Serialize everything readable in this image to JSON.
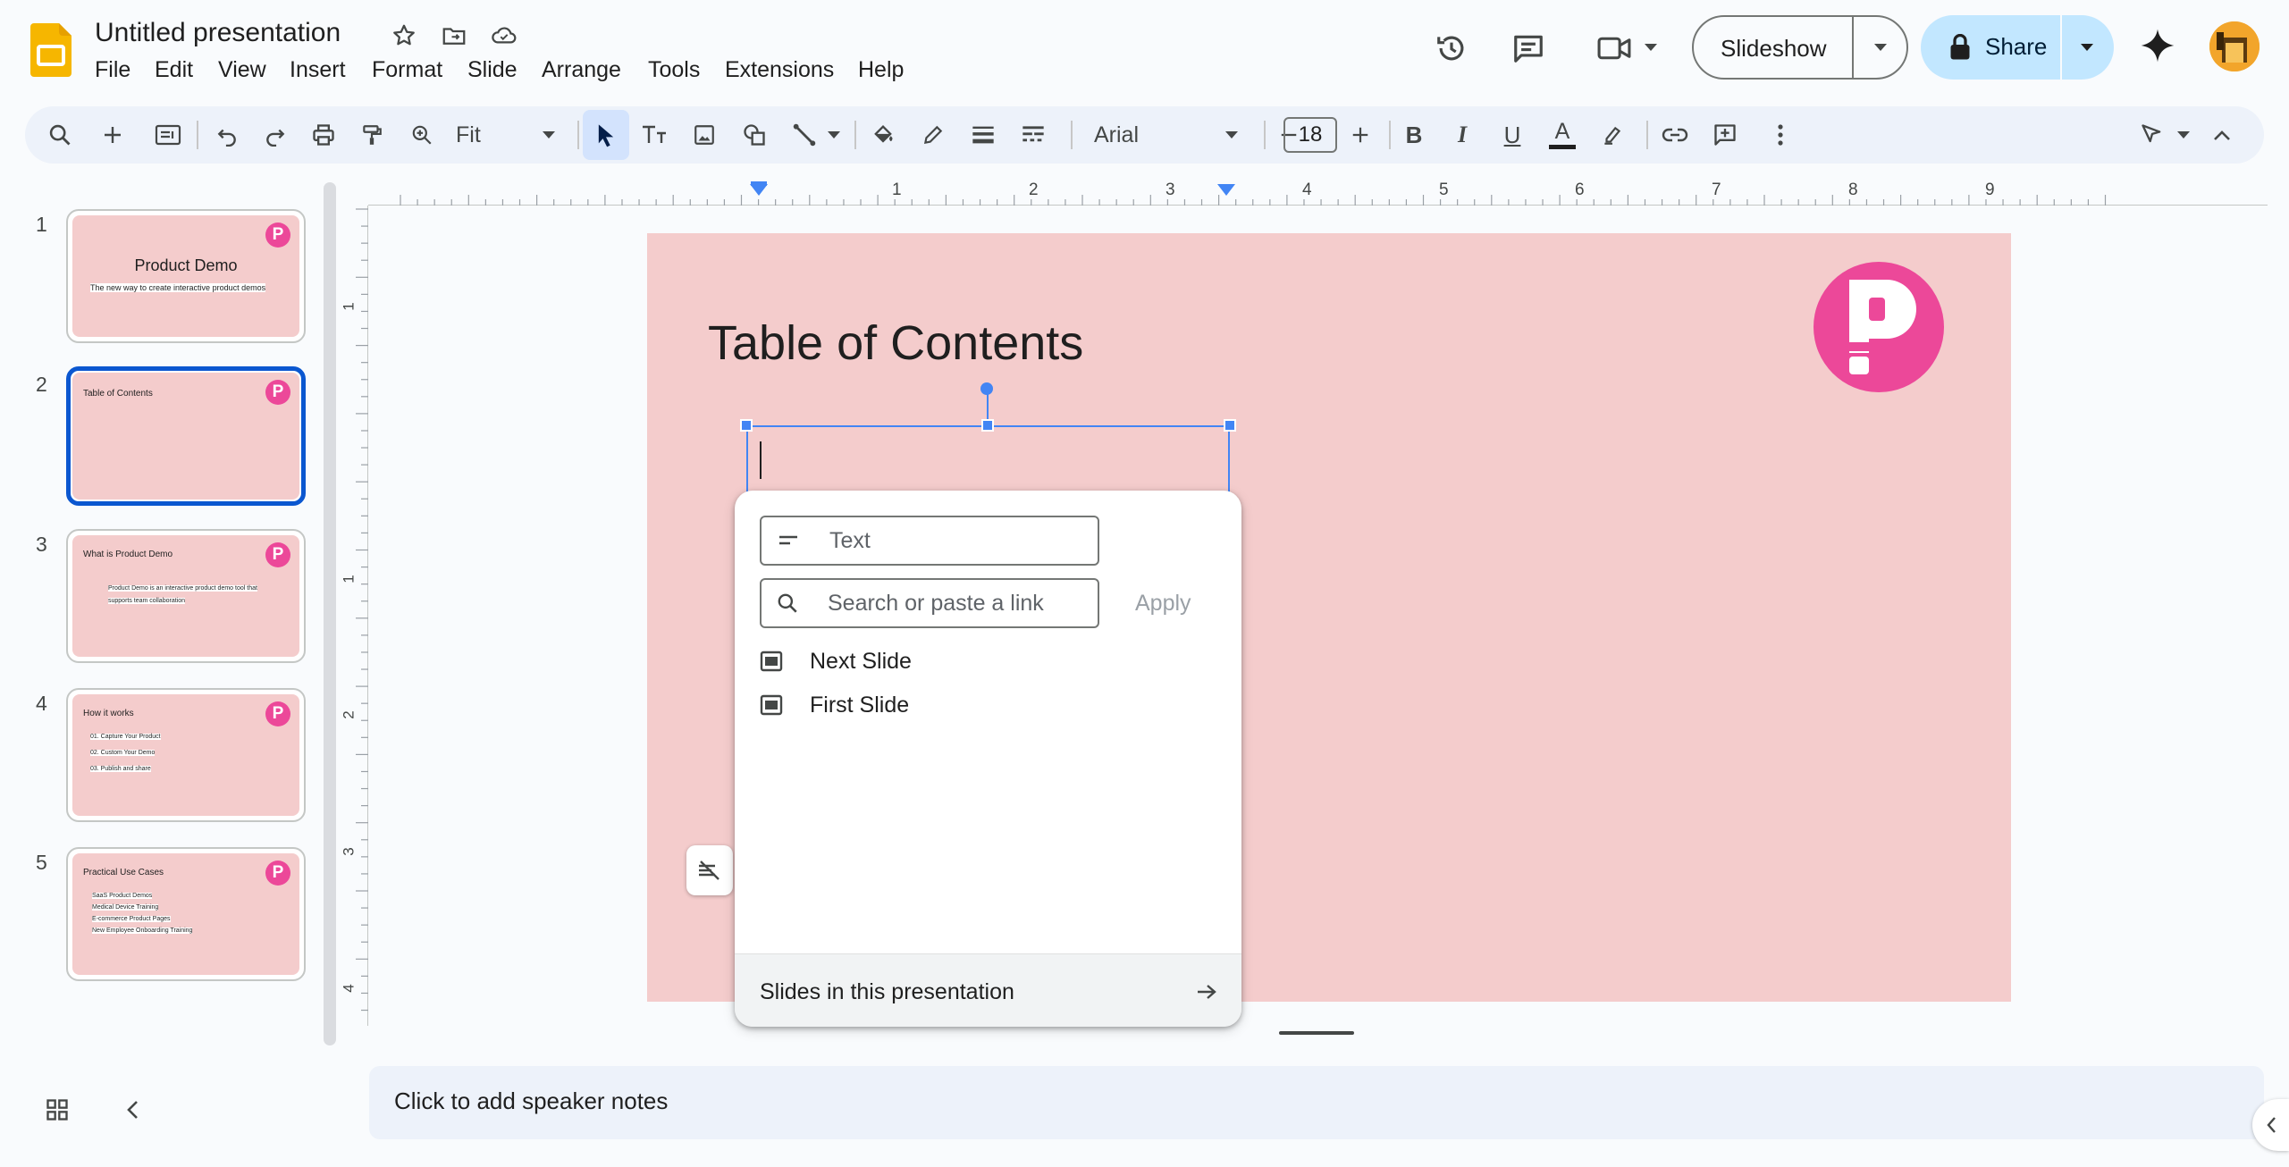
{
  "app": {
    "title": "Untitled presentation",
    "menus": [
      "File",
      "Edit",
      "View",
      "Insert",
      "Format",
      "Slide",
      "Arrange",
      "Tools",
      "Extensions",
      "Help"
    ],
    "slideshow_label": "Slideshow",
    "share_label": "Share"
  },
  "toolbar": {
    "zoom_label": "Fit",
    "font_name": "Arial",
    "font_size": "18"
  },
  "ruler": {
    "h_ticks": [
      "1",
      "2",
      "3",
      "4",
      "5",
      "6",
      "7",
      "8",
      "9"
    ],
    "v_ticks": [
      "1",
      "1",
      "2",
      "3",
      "4"
    ]
  },
  "thumbnails": [
    {
      "num": "1",
      "title": "Product Demo",
      "subtitle": "The new way to create interactive product demos",
      "logo": "P"
    },
    {
      "num": "2",
      "title": "Table of Contents",
      "logo": "P"
    },
    {
      "num": "3",
      "title": "What is Product Demo",
      "body1": "Product Demo is an interactive product demo tool that",
      "body2": "supports team collaboration",
      "logo": "P"
    },
    {
      "num": "4",
      "title": "How it works",
      "items": [
        "01. Capture Your Product",
        "02. Custom Your Demo",
        "03. Publish and share"
      ],
      "logo": "P"
    },
    {
      "num": "5",
      "title": "Practical Use Cases",
      "items": [
        "SaaS Product Demos",
        "Medical Device Training",
        "E-commerce Product Pages",
        "New Employee Onboarding Training"
      ],
      "logo": "P"
    }
  ],
  "slide": {
    "title": "Table of Contents",
    "logo_letter": "P",
    "background_color": "#f4cccc",
    "logo_color": "#ec4899"
  },
  "link_popup": {
    "text_placeholder": "Text",
    "link_placeholder": "Search or paste a link",
    "apply_label": "Apply",
    "options": [
      "Next Slide",
      "First Slide"
    ],
    "footer_label": "Slides in this presentation"
  },
  "speaker_notes": {
    "placeholder": "Click to add speaker notes"
  },
  "colors": {
    "accent": "#0b57d0",
    "share_bg": "#c2e7ff",
    "toolbar_bg": "#edf2fa"
  }
}
